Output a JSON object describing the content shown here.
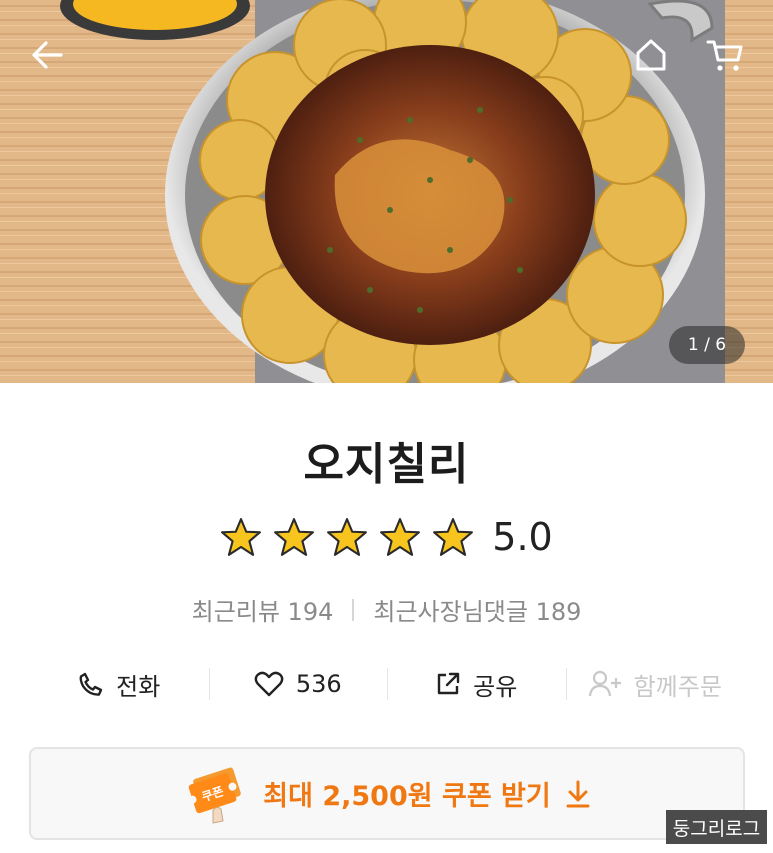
{
  "hero": {
    "image_description": "food-photo",
    "counter": "1 / 6"
  },
  "nav": {
    "back_icon": "arrow-left-icon",
    "home_icon": "home-icon",
    "cart_icon": "cart-icon"
  },
  "store": {
    "name": "오지칠리",
    "rating": 5.0,
    "rating_text": "5.0",
    "stars_filled": 5,
    "recent_reviews_label": "최근리뷰 194",
    "owner_replies_label": "최근사장님댓글 189"
  },
  "actions": {
    "call_label": "전화",
    "like_count": "536",
    "share_label": "공유",
    "group_order_label": "함께주문"
  },
  "coupon": {
    "label": "최대 2,500원 쿠폰 받기",
    "badge_text": "쿠폰"
  },
  "watermark": "둥그리로그",
  "colors": {
    "accent": "#f07812",
    "star": "#f7c51e",
    "disabled": "#c8c8c8"
  }
}
